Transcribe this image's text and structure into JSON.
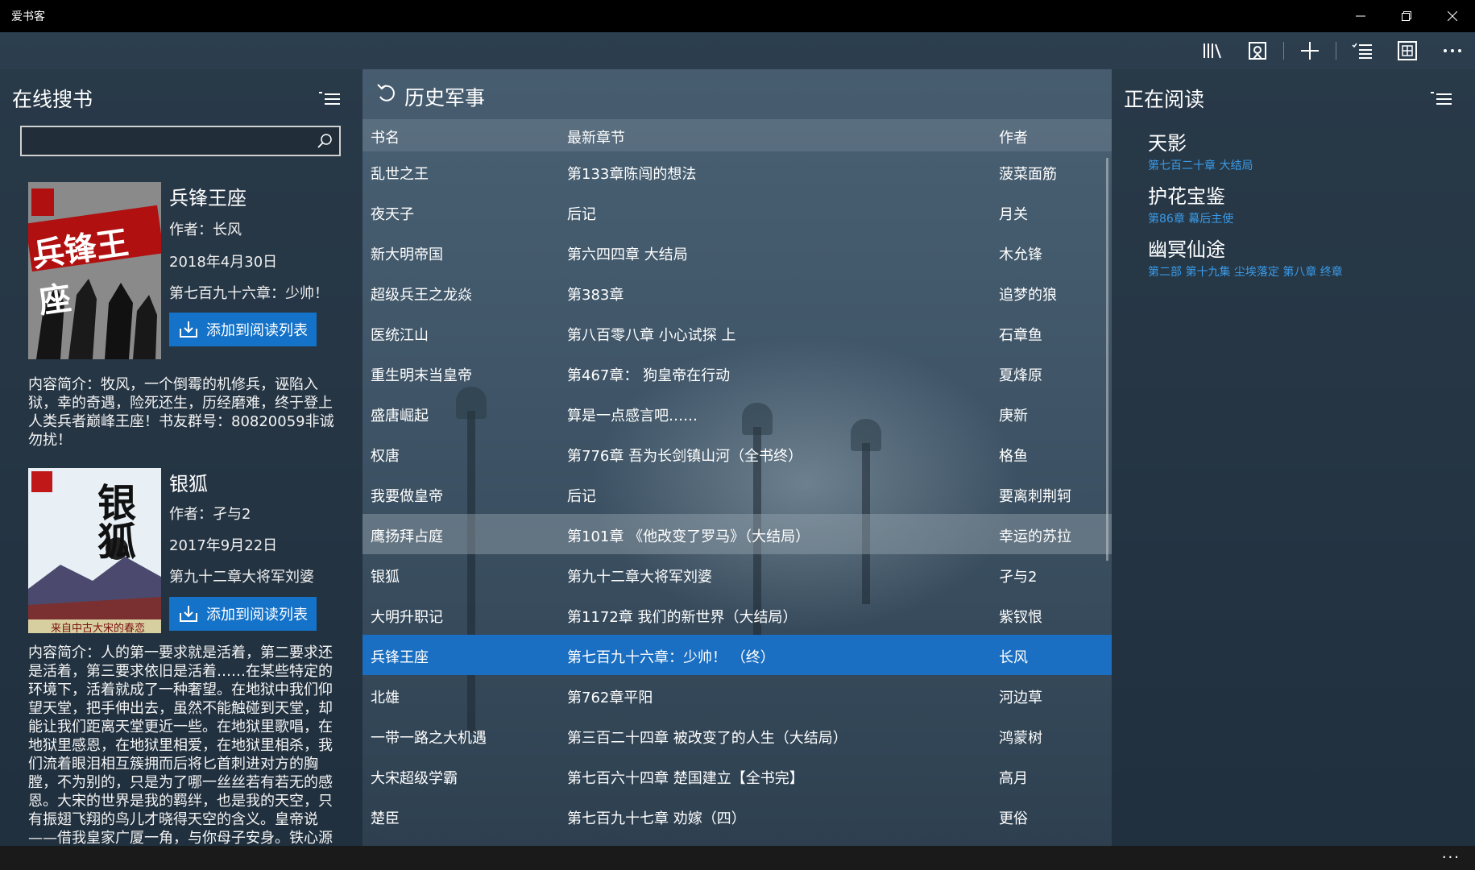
{
  "window": {
    "title": "爱书客",
    "controls": [
      "minimize",
      "restore",
      "close"
    ]
  },
  "commandbar": {
    "icons": [
      "library-icon",
      "bookmark-icon",
      "add-icon",
      "list-icon",
      "grid-icon",
      "more-icon"
    ]
  },
  "left_panel": {
    "title": "在线搜书",
    "search": {
      "value": "",
      "placeholder": ""
    },
    "books": [
      {
        "title": "兵锋王座",
        "author": "作者：长风",
        "date": "2018年4月30日",
        "latest": "第七百九十六章：少帅！",
        "button": "添加到阅读列表",
        "cover_text": "兵锋王座",
        "description": "内容简介：牧风，一个倒霉的机修兵，诬陷入狱，幸的奇遇，险死还生，历经磨难，终于登上人类兵者巅峰王座！书友群号：80820059非诚勿扰！"
      },
      {
        "title": "银狐",
        "author": "作者：孑与2",
        "date": "2017年9月22日",
        "latest": "第九十二章大将军刘婆",
        "button": "添加到阅读列表",
        "cover_text": "银狐",
        "cover_bottom": "来自中古大宋的春恋",
        "description": "内容简介：人的第一要求就是活着，第二要求还是活着，第三要求依旧是活着……在某些特定的环境下，活着就成了一种奢望。在地狱中我们仰望天堂，把手伸出去，虽然不能触碰到天堂，却能让我们距离天堂更近一些。在地狱里歌唱，在地狱里感恩，在地狱里相爱，在地狱里相杀，我们流着眼泪相互簇拥而后将匕首刺进对方的胸膛，不为别的，只是为了哪一丝丝若有若无的感恩。大宋的世界是我的羁绊，也是我的天空，只有振翅飞翔的鸟儿才晓得天空的含义。皇帝说——借我皇家广厦一角，与你母子安身。铁心源说——"
      }
    ]
  },
  "middle_panel": {
    "title": "历史军事",
    "columns": [
      "书名",
      "最新章节",
      "作者"
    ],
    "rows": [
      [
        "乱世之王",
        "第133章陈闯的想法",
        "菠菜面筋"
      ],
      [
        "夜天子",
        "后记",
        "月关"
      ],
      [
        "新大明帝国",
        "第六四四章 大结局",
        "木允锋"
      ],
      [
        "超级兵王之龙焱",
        "第383章",
        "追梦的狼"
      ],
      [
        "医统江山",
        "第八百零八章 小心试探 上",
        "石章鱼"
      ],
      [
        "重生明末当皇帝",
        "第467章： 狗皇帝在行动",
        "夏烽原"
      ],
      [
        "盛唐崛起",
        "算是一点感言吧……",
        "庚新"
      ],
      [
        "权唐",
        "第776章 吾为长剑镇山河（全书终）",
        "格鱼"
      ],
      [
        "我要做皇帝",
        "后记",
        "要离刺荆轲"
      ],
      [
        "鹰扬拜占庭",
        "第101章 《他改变了罗马》（大结局）",
        "幸运的苏拉"
      ],
      [
        "银狐",
        "第九十二章大将军刘婆",
        "孑与2"
      ],
      [
        "大明升职记",
        "第1172章 我们的新世界（大结局）",
        "紫钗恨"
      ],
      [
        "兵锋王座",
        "第七百九十六章：少帅！ （终）",
        "长风"
      ],
      [
        "北雄",
        "第762章平阳",
        "河边草"
      ],
      [
        "一带一路之大机遇",
        "第三百二十四章 被改变了的人生（大结局）",
        "鸿蒙树"
      ],
      [
        "大宋超级学霸",
        "第七百六十四章 楚国建立【全书完】",
        "高月"
      ],
      [
        "楚臣",
        "第七百九十七章 劝嫁（四）",
        "更俗"
      ]
    ],
    "hover_row": 9,
    "selected_row": 12
  },
  "right_panel": {
    "title": "正在阅读",
    "items": [
      {
        "title": "天影",
        "chapter": "第七百二十章 大结局"
      },
      {
        "title": "护花宝鉴",
        "chapter": "第86章 幕后主使"
      },
      {
        "title": "幽冥仙途",
        "chapter": "第二部 第十九集 尘埃落定 第八章 终章"
      }
    ]
  },
  "bottombar": {
    "more": "···"
  },
  "colors": {
    "accent": "#1b6fc2",
    "button": "#1472c8",
    "link": "#3a9be8"
  }
}
